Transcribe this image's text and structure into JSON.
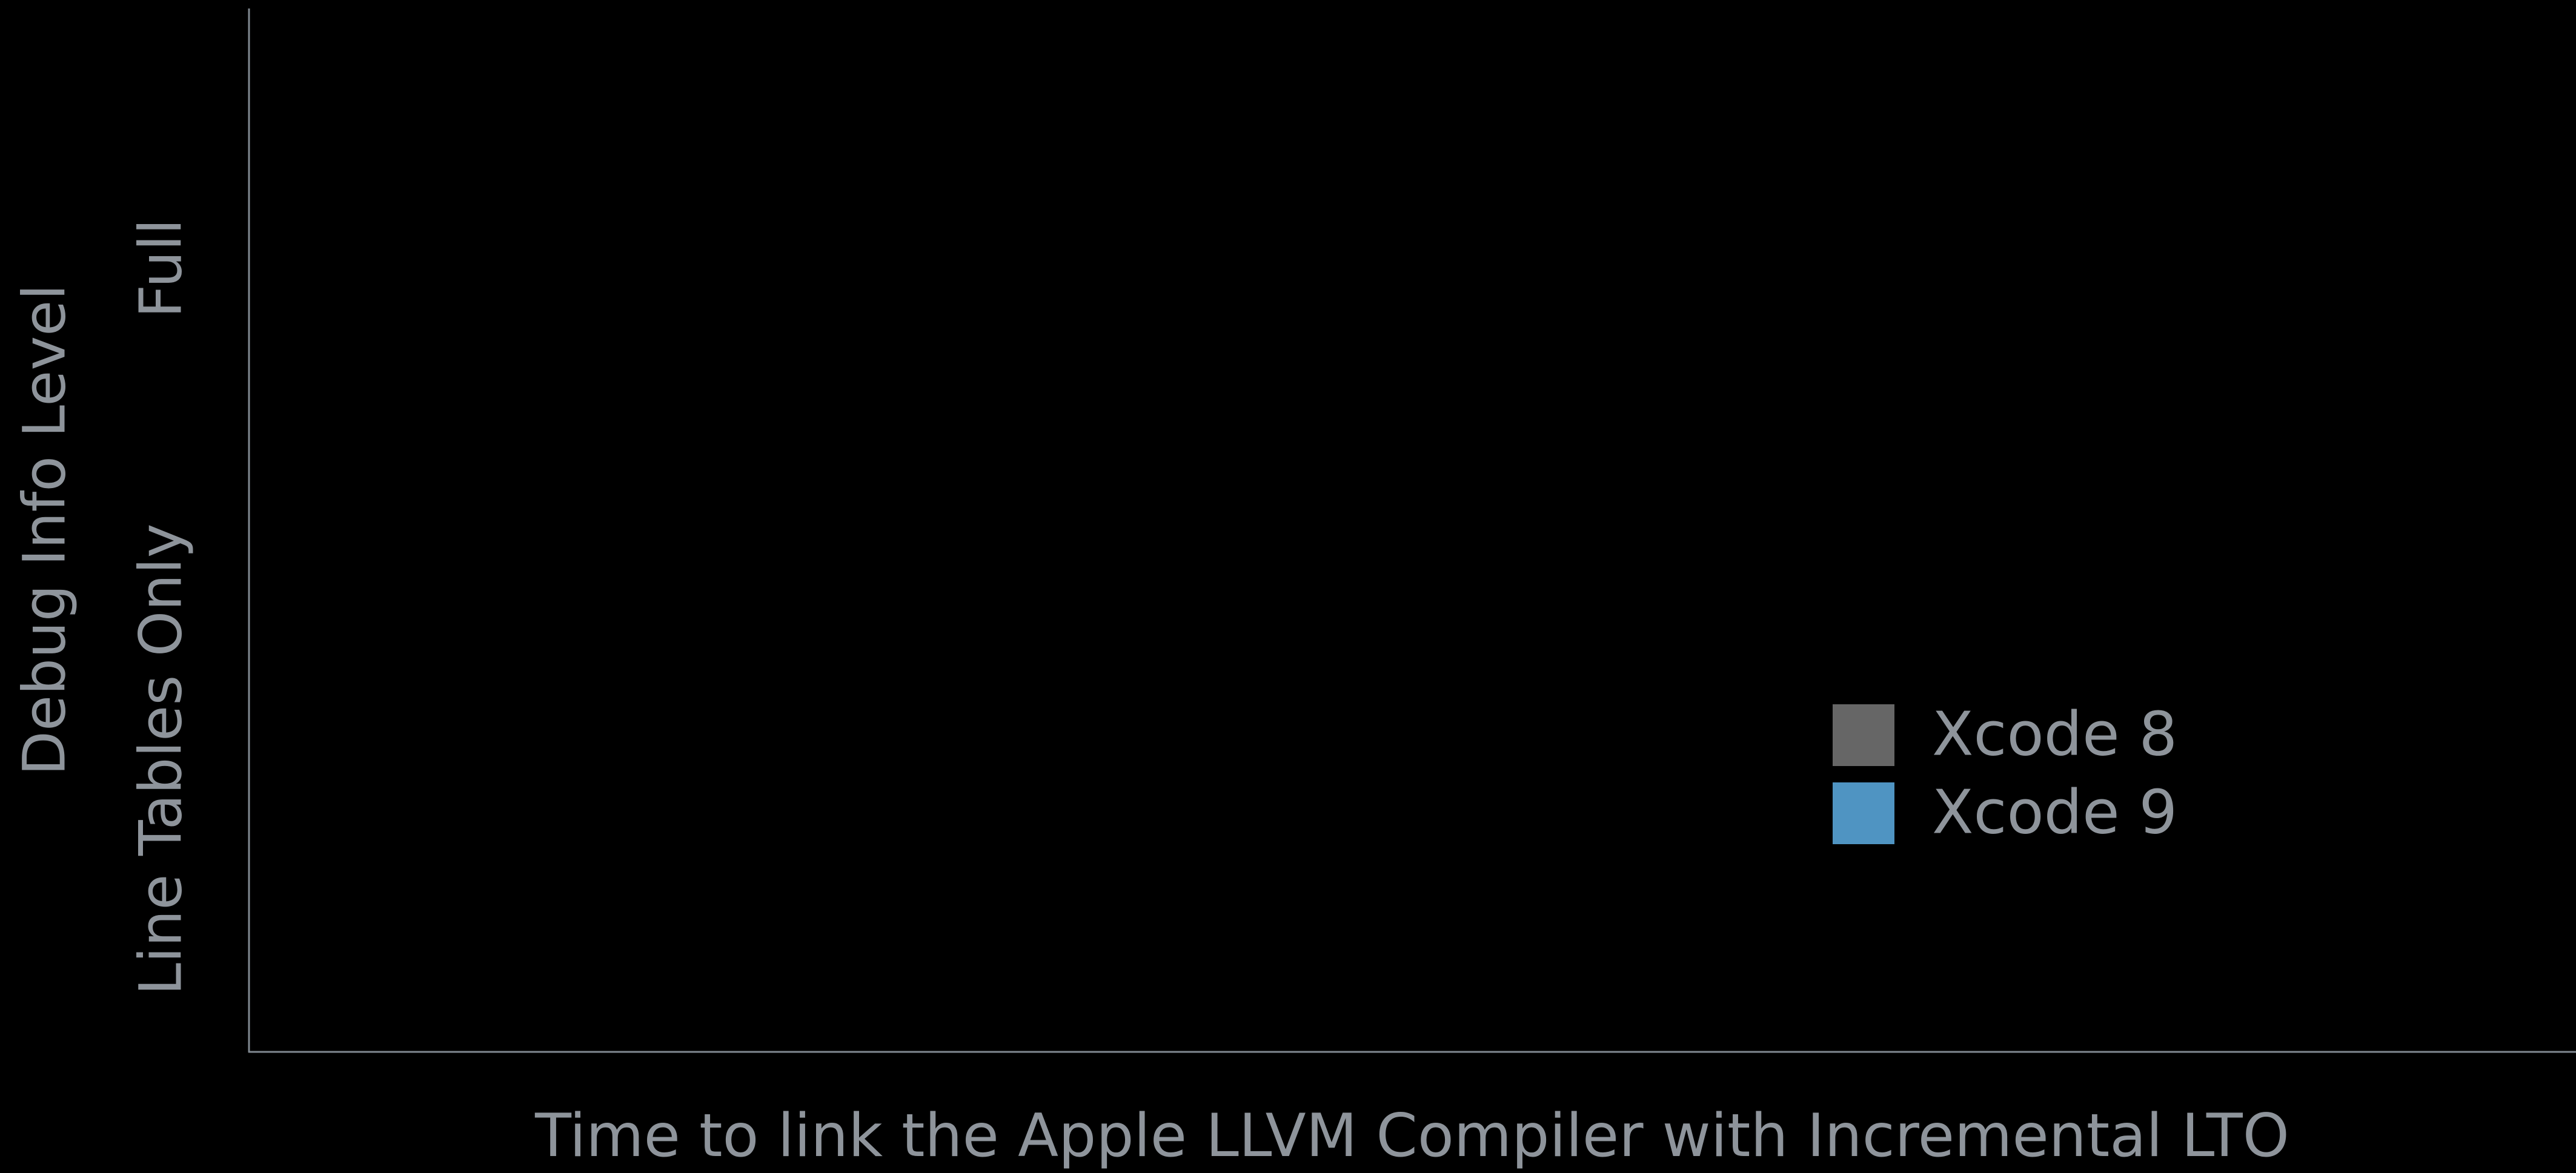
{
  "chart_data": {
    "type": "bar",
    "orientation": "horizontal",
    "categories": [
      "Full",
      "Line Tables Only"
    ],
    "series": [
      {
        "name": "Xcode 8",
        "color": "#666666",
        "values": [
          null,
          null
        ]
      },
      {
        "name": "Xcode 9",
        "color": "#4f94c2",
        "values": [
          null,
          null
        ]
      }
    ],
    "xlabel": "Time to link the Apple LLVM Compiler with Incremental LTO",
    "ylabel": "Debug Info Level",
    "legend_position": "lower-right",
    "grid": false,
    "colors": {
      "background": "#000000",
      "text": "#8e949b",
      "axis": "#808890"
    }
  }
}
